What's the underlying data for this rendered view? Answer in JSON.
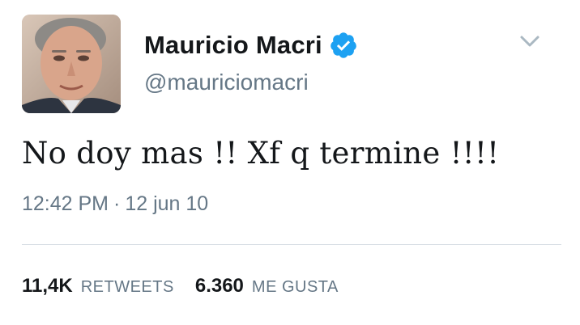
{
  "tweet": {
    "display_name": "Mauricio Macri",
    "username": "@mauriciomacri",
    "verified_icon": "verified-badge-icon",
    "text": "No doy mas !! Xf q termine !!!!",
    "time": "12:42 PM",
    "separator": "·",
    "date": "12 jun 10"
  },
  "stats": {
    "retweets_count": "11,4K",
    "retweets_label": "RETWEETS",
    "likes_count": "6.360",
    "likes_label": "ME GUSTA"
  },
  "colors": {
    "verified_blue": "#1da1f2",
    "secondary_text": "#657786",
    "primary_text": "#14171a",
    "divider": "#d7dee4"
  },
  "icons": {
    "menu": "chevron-down-icon"
  }
}
